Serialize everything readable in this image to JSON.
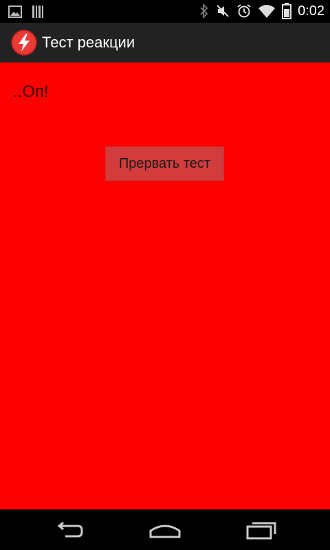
{
  "status_bar": {
    "time": "0:02",
    "left_icons": [
      "image-notification-icon",
      "barcode-notification-icon"
    ],
    "right_icons": [
      "bluetooth-icon",
      "mute-icon",
      "alarm-icon",
      "wifi-icon",
      "battery-icon"
    ]
  },
  "action_bar": {
    "app_icon": "lightning-app-icon",
    "title": "Тест реакции"
  },
  "content": {
    "background": "#ff0000",
    "message": "..Оп!",
    "abort_button_label": "Прервать тест"
  },
  "nav_bar": {
    "buttons": [
      "back-icon",
      "home-icon",
      "recents-icon"
    ]
  }
}
